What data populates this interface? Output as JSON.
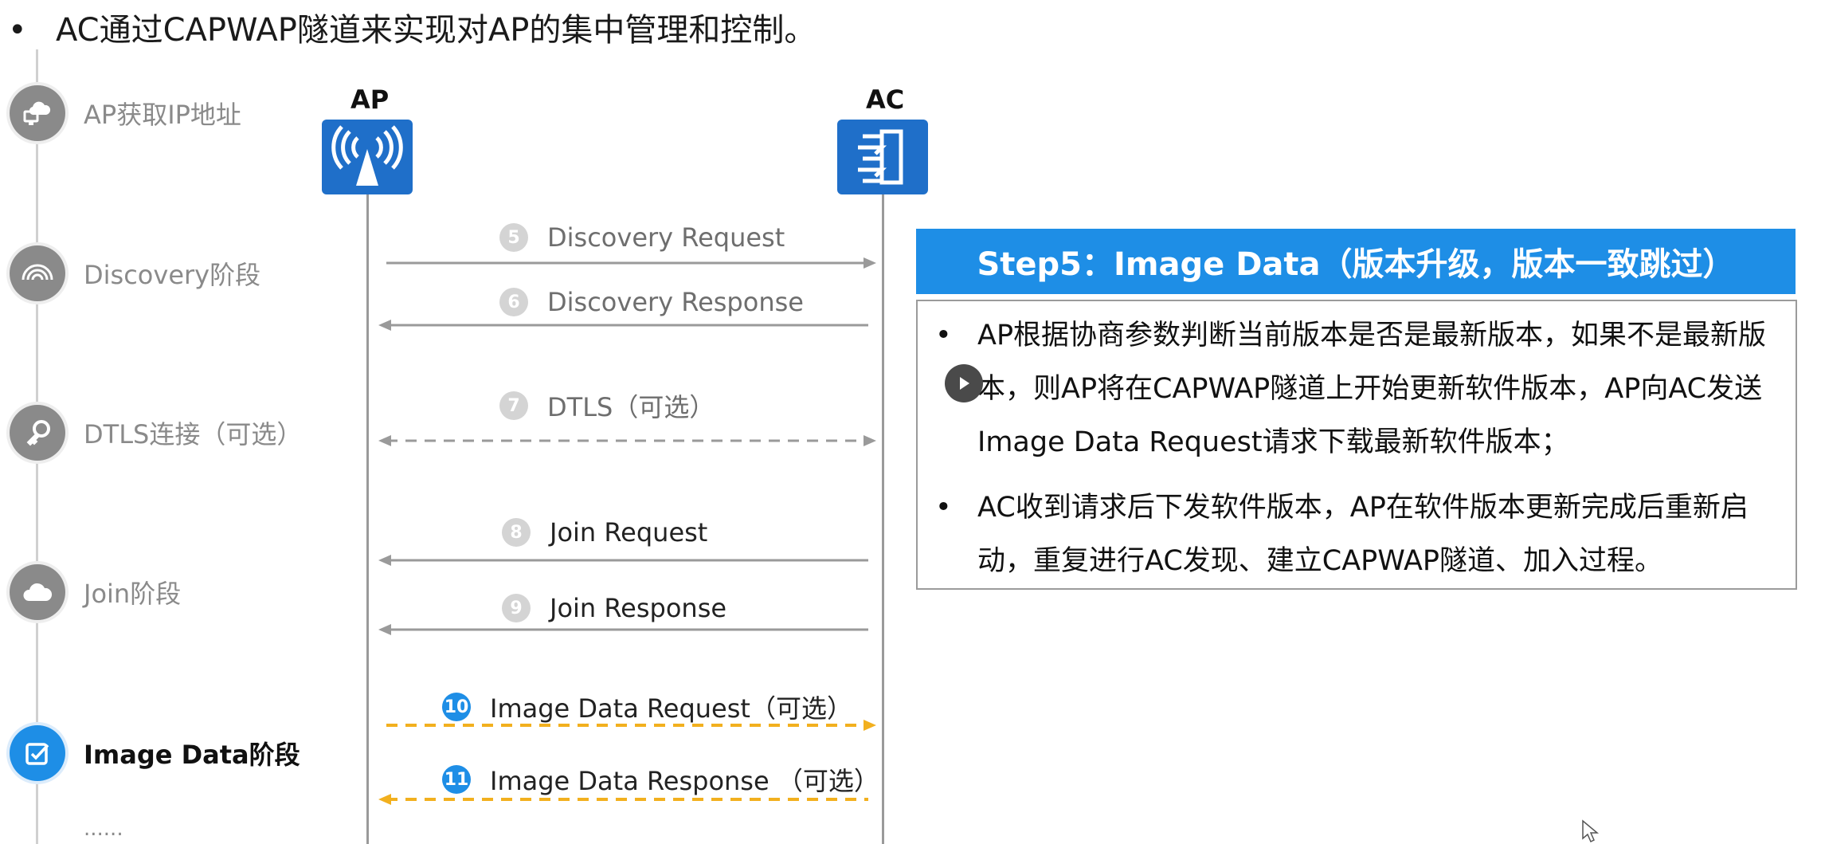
{
  "title": "AC通过CAPWAP隧道来实现对AP的集中管理和控制。",
  "bullet_char": "•",
  "stages": [
    {
      "label": "AP获取IP地址",
      "icon": "network-computer-icon",
      "active": false
    },
    {
      "label": "Discovery阶段",
      "icon": "wifi-signal-icon",
      "active": false
    },
    {
      "label": "DTLS连接（可选）",
      "icon": "key-icon",
      "active": false
    },
    {
      "label": "Join阶段",
      "icon": "cloud-icon",
      "active": false
    },
    {
      "label": "Image Data阶段",
      "icon": "checkbox-edit-icon",
      "active": true
    }
  ],
  "more_label": "......",
  "entities": {
    "ap": "AP",
    "ac": "AC"
  },
  "messages": [
    {
      "num": "5",
      "label": "Discovery Request",
      "direction": "right",
      "style": "solid",
      "color": "#9a9a9a"
    },
    {
      "num": "6",
      "label": "Discovery Response",
      "direction": "left",
      "style": "solid",
      "color": "#9a9a9a"
    },
    {
      "num": "7",
      "label": "DTLS（可选）",
      "direction": "both",
      "style": "dashed",
      "color": "#9a9a9a"
    },
    {
      "num": "8",
      "label": "Join Request",
      "direction": "left",
      "style": "solid",
      "color": "#9a9a9a"
    },
    {
      "num": "9",
      "label": "Join Response",
      "direction": "left",
      "style": "solid",
      "color": "#9a9a9a"
    },
    {
      "num": "10",
      "label": "Image Data Request（可选）",
      "direction": "right",
      "style": "dashed",
      "color": "#f2b01e"
    },
    {
      "num": "11",
      "label": "Image Data Response （可选）",
      "direction": "left",
      "style": "dashed",
      "color": "#f2b01e"
    }
  ],
  "step": {
    "header": "Step5：Image Data（版本升级，版本一致跳过）",
    "bullets": [
      "AP根据协商参数判断当前版本是否是最新版本，如果不是最新版本，则AP将在CAPWAP隧道上开始更新软件版本，AP向AC发送Image Data Request请求下载最新软件版本；",
      "AC收到请求后下发软件版本，AP在软件版本更新完成后重新启动，重复进行AC发现、建立CAPWAP隧道、加入过程。"
    ]
  },
  "colors": {
    "accent": "#1e8ee6",
    "entity": "#1f6fc9",
    "gray": "#8a8a8a",
    "optional": "#f2b01e"
  }
}
